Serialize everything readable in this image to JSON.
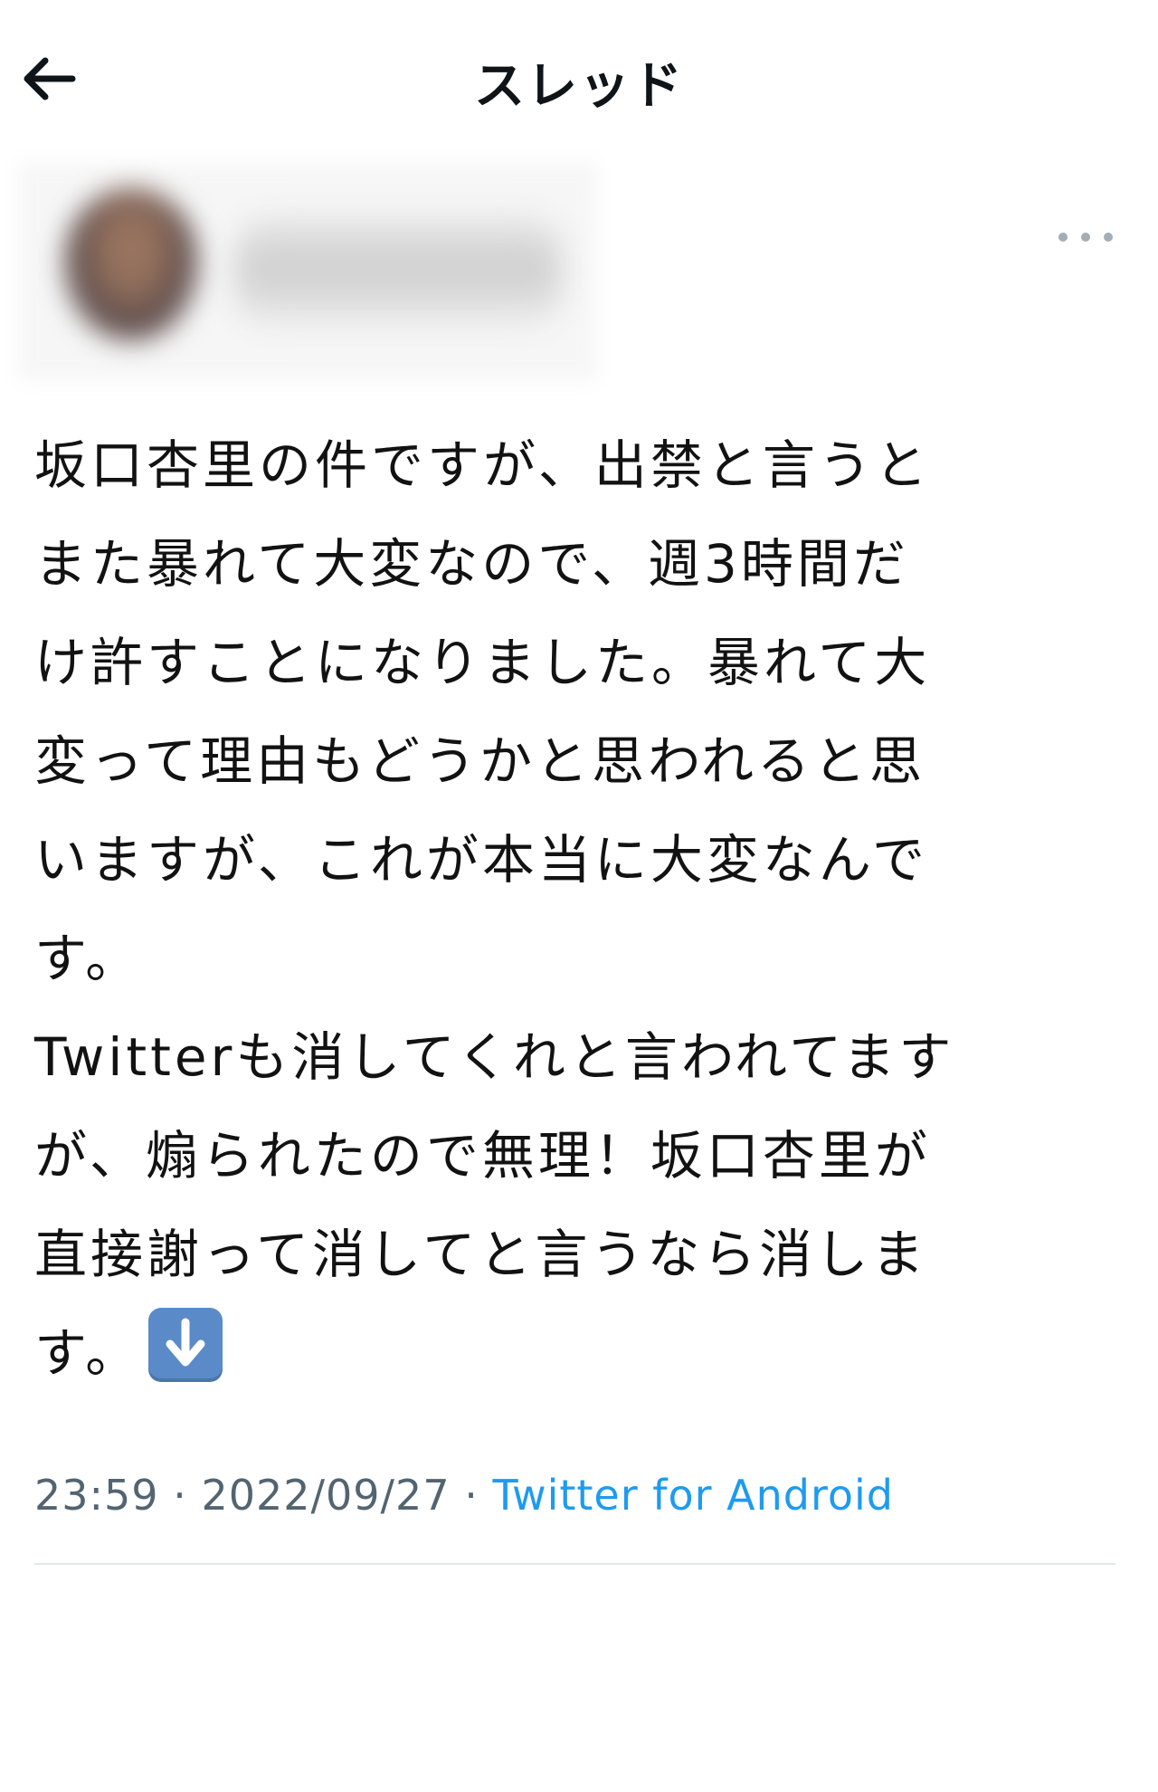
{
  "header": {
    "title": "スレッド",
    "back_icon": "arrow-left-icon"
  },
  "author": {
    "avatar": "blurred",
    "name": "blurred",
    "more_icon": "more-horizontal-icon"
  },
  "tweet": {
    "lines": [
      "坂口杏里の件ですが、出禁と言うと",
      "また暴れて大変なので、週3時間だ",
      "け許すことになりました。暴れて大",
      "変って理由もどうかと思われると思",
      "いますが、これが本当に大変なんで",
      "す。",
      "Twitterも消してくれと言われてます",
      "が、煽られたので無理！坂口杏里が",
      "直接謝って消してと言うなら消しま",
      "す。"
    ],
    "emoji": "down-arrow-emoji-icon"
  },
  "meta": {
    "time": "23:59",
    "sep1": " · ",
    "date": "2022/09/27",
    "sep2": " · ",
    "source": "Twitter for Android"
  },
  "colors": {
    "text": "#0f1419",
    "meta_gray": "#536471",
    "link_blue": "#1d9bf0",
    "divider": "#e3e7ea",
    "emoji_blue": "#5a8bc8"
  }
}
